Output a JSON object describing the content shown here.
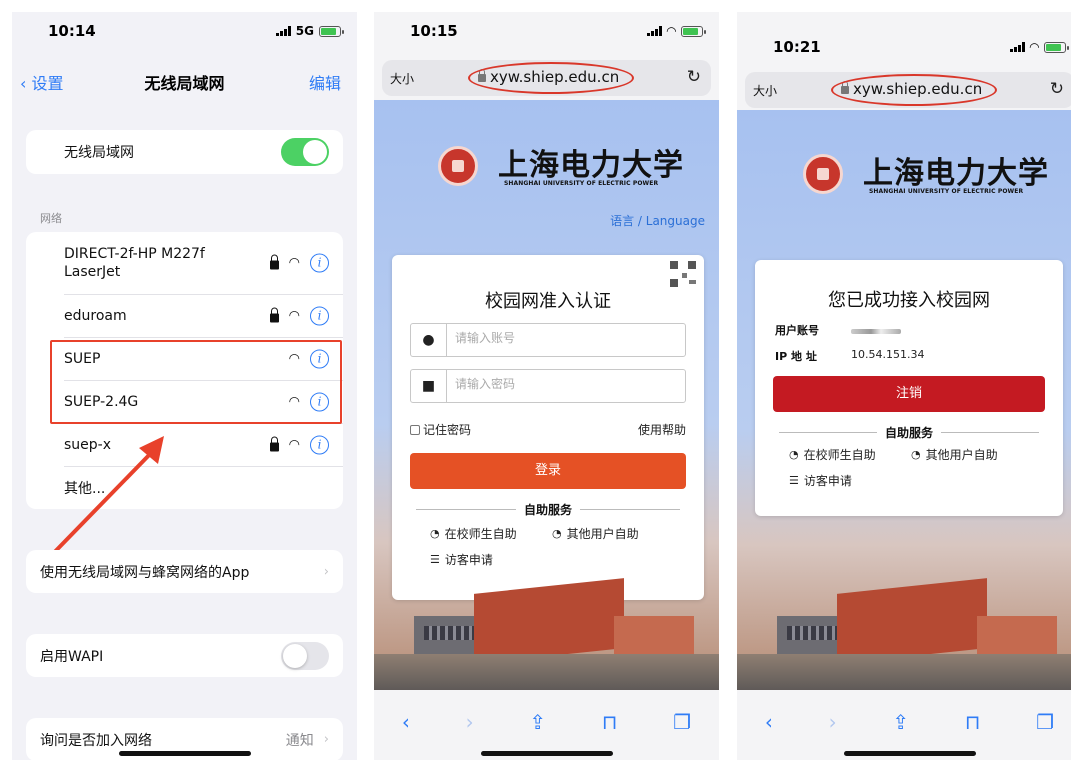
{
  "panel1": {
    "time": "10:14",
    "network_type": "5G",
    "nav": {
      "back": "设置",
      "title": "无线局域网",
      "edit": "编辑"
    },
    "wifi_toggle_label": "无线局域网",
    "wifi_enabled": true,
    "section_networks": "网络",
    "networks": [
      {
        "name_line1": "DIRECT-2f-HP M227f",
        "name_line2": "LaserJet",
        "locked": true
      },
      {
        "name": "eduroam",
        "locked": true
      },
      {
        "name": "SUEP",
        "locked": false
      },
      {
        "name": "SUEP-2.4G",
        "locked": false
      },
      {
        "name": "suep-x",
        "locked": true
      },
      {
        "name": "其他...",
        "locked": false
      }
    ],
    "apps_row": "使用无线局域网与蜂窝网络的App",
    "wapi_row": "启用WAPI",
    "wapi_enabled": false,
    "ask_join_row": "询问是否加入网络",
    "ask_join_value": "通知",
    "highlight_color": "#e8412b"
  },
  "panel2": {
    "time": "10:15",
    "text_size": "大小",
    "url": "xyw.shiep.edu.cn",
    "university_cn": "上海电力大学",
    "university_en": "SHANGHAI UNIVERSITY OF ELECTRIC POWER",
    "language_link": "语言 / Language",
    "card_title": "校园网准入认证",
    "account_placeholder": "请输入账号",
    "password_placeholder": "请输入密码",
    "remember_label": "记住密码",
    "help_link": "使用帮助",
    "login_button": "登录",
    "self_service": "自助服务",
    "svc_teacher": "在校师生自助",
    "svc_other": "其他用户自助",
    "svc_visitor": "访客申请",
    "login_color": "#e55125"
  },
  "panel3": {
    "time": "10:21",
    "text_size": "大小",
    "url": "xyw.shiep.edu.cn",
    "university_cn": "上海电力大学",
    "university_en": "SHANGHAI UNIVERSITY OF ELECTRIC POWER",
    "card_title": "您已成功接入校园网",
    "account_label": "用户账号",
    "ip_label": "IP 地 址",
    "ip_value": "10.54.151.34",
    "logout_button": "注销",
    "self_service": "自助服务",
    "svc_teacher": "在校师生自助",
    "svc_other": "其他用户自助",
    "svc_visitor": "访客申请",
    "logout_color": "#c41a22"
  },
  "icons": [
    "chevron-left-icon",
    "lock-icon",
    "wifi-icon",
    "info-icon",
    "reload-icon",
    "user-icon",
    "lock-fill-icon",
    "qr-icon",
    "back-icon",
    "forward-icon",
    "share-icon",
    "bookmarks-icon",
    "tabs-icon"
  ]
}
